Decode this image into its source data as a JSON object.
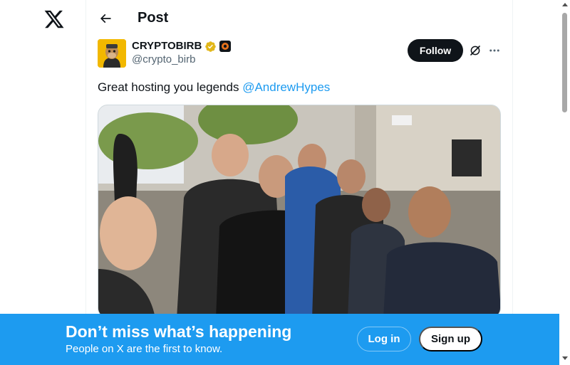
{
  "header": {
    "title": "Post"
  },
  "post": {
    "author": {
      "display_name": "CRYPTOBIRB",
      "handle": "@crypto_birb"
    },
    "follow_label": "Follow",
    "text_prefix": "Great hosting you legends ",
    "mention": "@AndrewHypes"
  },
  "banner": {
    "title": "Don’t miss what’s happening",
    "subtitle": "People on X are the first to know.",
    "login_label": "Log in",
    "signup_label": "Sign up"
  },
  "icons": {
    "logo": "x-logo-icon",
    "back": "back-arrow-icon",
    "verified": "verified-badge-icon",
    "affiliate": "affiliate-badge-icon",
    "grok": "grok-icon",
    "more": "more-icon"
  },
  "colors": {
    "accent": "#1d9bf0",
    "verified_gold": "#e2b719",
    "text_primary": "#0f1419",
    "text_secondary": "#536471"
  }
}
